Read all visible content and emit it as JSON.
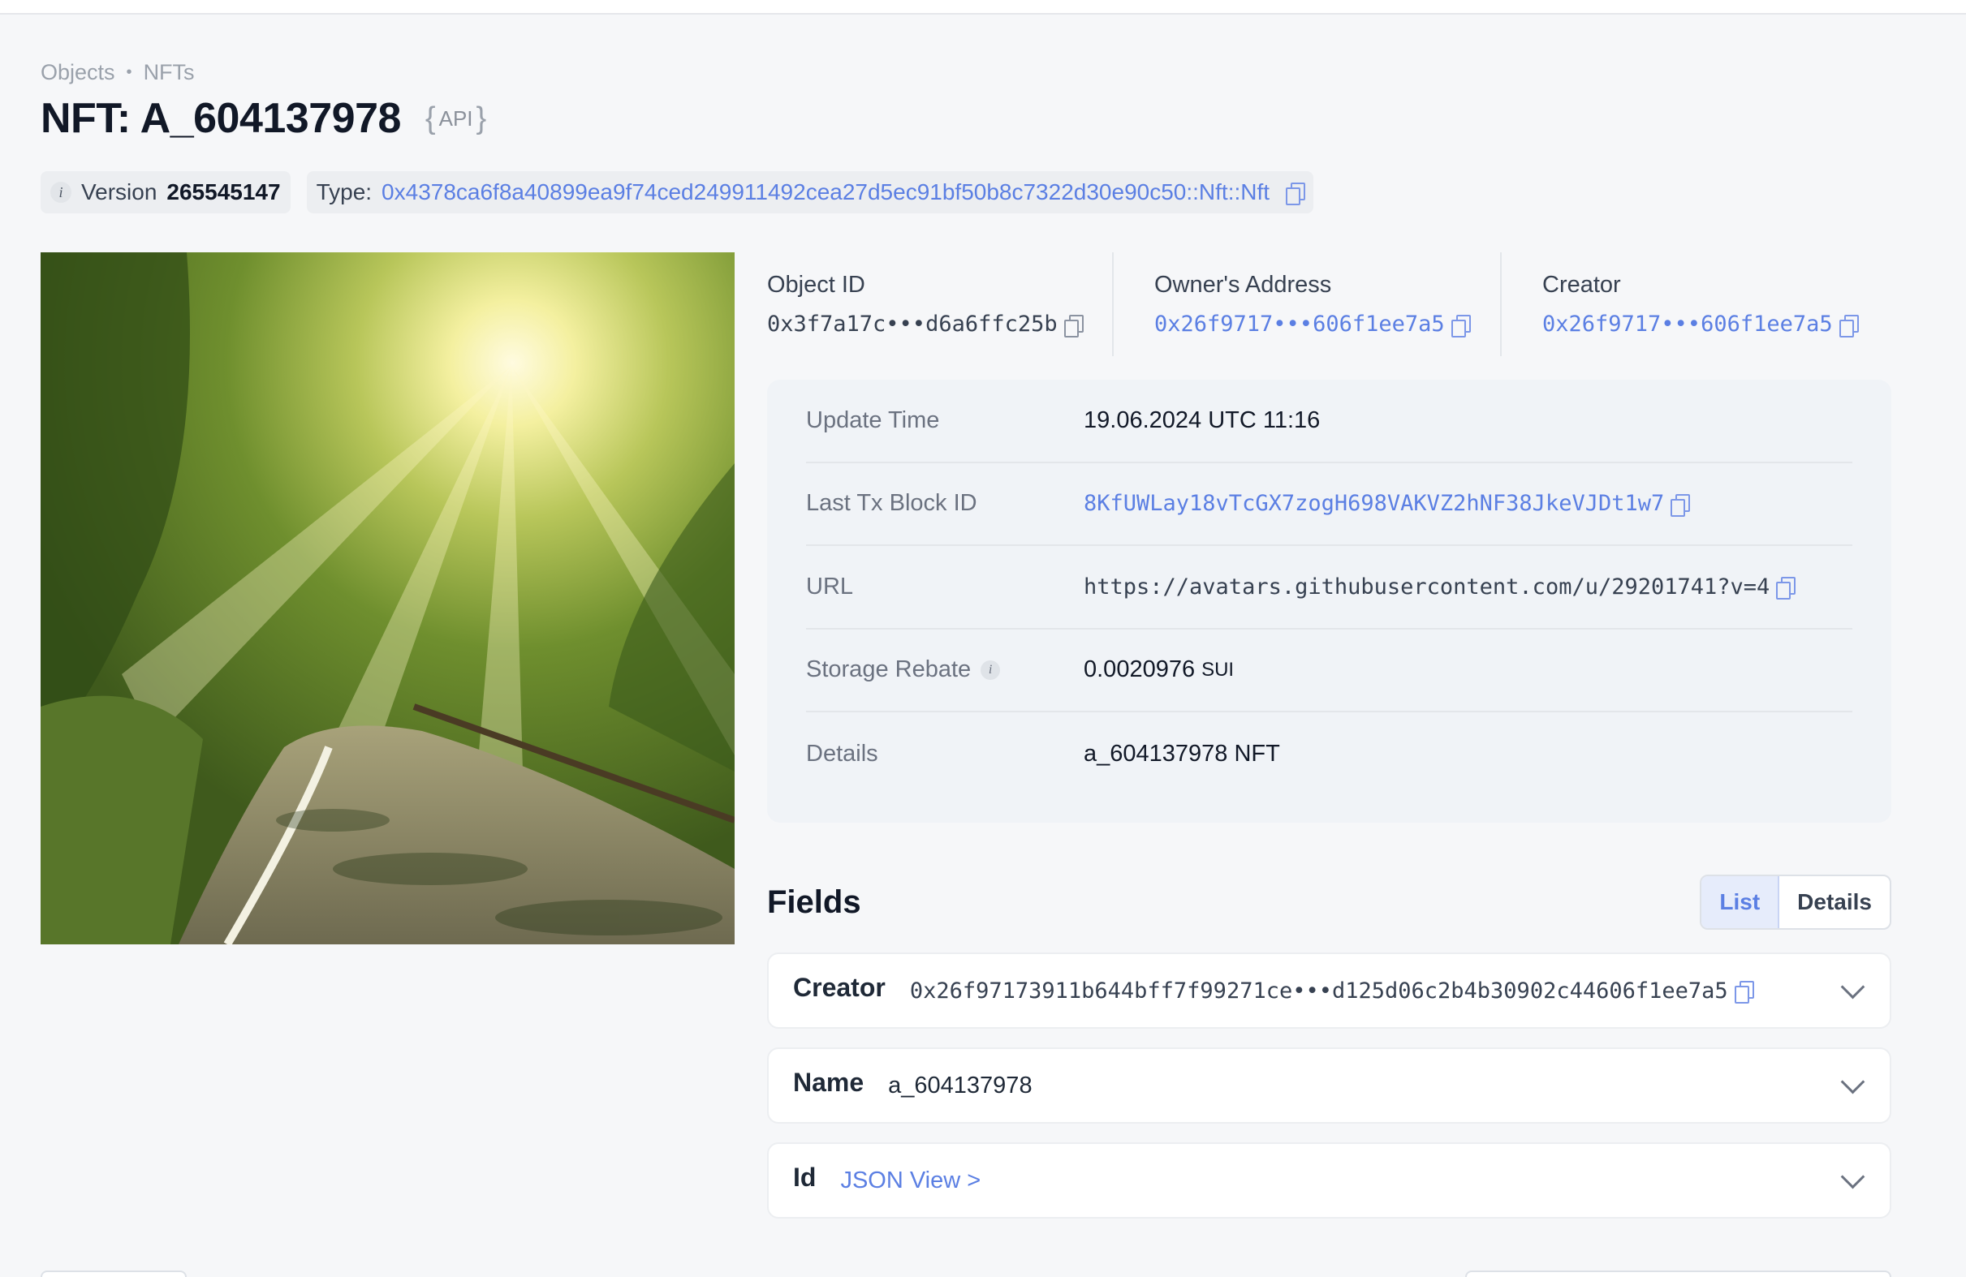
{
  "breadcrumb": {
    "items": [
      "Objects",
      "NFTs"
    ]
  },
  "page": {
    "title": "NFT: A_604137978",
    "api_label": "API"
  },
  "meta": {
    "info_glyph": "i",
    "version_label": "Version",
    "version_value": "265545147",
    "type_label": "Type:",
    "type_value": "0x4378ca6f8a40899ea9f74ced249911492cea27d5ec91bf50b8c7322d30e90c50::Nft::Nft"
  },
  "stats": {
    "object_id": {
      "label": "Object ID",
      "value": "0x3f7a17c•••d6a6ffc25b"
    },
    "owner": {
      "label": "Owner's Address",
      "value": "0x26f9717•••606f1ee7a5"
    },
    "creator": {
      "label": "Creator",
      "value": "0x26f9717•••606f1ee7a5"
    }
  },
  "details": {
    "update_time": {
      "label": "Update Time",
      "value": "19.06.2024 UTC 11:16"
    },
    "last_tx": {
      "label": "Last Tx Block ID",
      "value": "8KfUWLay18vTcGX7zogH698VAKVZ2hNF38JkeVJDt1w7"
    },
    "url": {
      "label": "URL",
      "value": "https://avatars.githubusercontent.com/u/29201741?v=4"
    },
    "storage_rebate": {
      "label": "Storage Rebate",
      "value": "0.0020976",
      "unit": "SUI"
    },
    "details": {
      "label": "Details",
      "value": "a_604137978 NFT"
    }
  },
  "fields": {
    "title": "Fields",
    "view_options": [
      "List",
      "Details"
    ],
    "active_view": "List",
    "items": [
      {
        "name": "Creator",
        "value": "0x26f97173911b644bff7f99271ce•••d125d06c2b4b30902c44606f1ee7a5"
      },
      {
        "name": "Name",
        "value": "a_604137978"
      },
      {
        "name": "Id",
        "value": "JSON View >"
      }
    ]
  },
  "icons": [
    "copy-icon",
    "info-icon",
    "chevron-down-icon"
  ],
  "colors": {
    "link": "#5b7fe3",
    "background": "#f6f7f9",
    "card": "#f0f3f7"
  }
}
